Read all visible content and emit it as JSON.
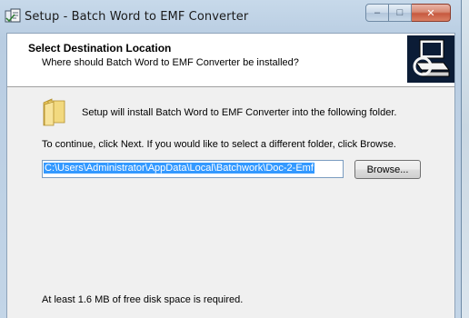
{
  "window": {
    "title": "Setup - Batch Word to EMF Converter",
    "controls": {
      "minimize": "–",
      "maximize": "□",
      "close": "✕"
    }
  },
  "header": {
    "title": "Select Destination Location",
    "subtitle": "Where should Batch Word to EMF Converter be installed?"
  },
  "body": {
    "install_text": "Setup will install Batch Word to EMF Converter into the following folder.",
    "instruction_text": "To continue, click Next. If you would like to select a different folder, click Browse.",
    "path_value": "C:\\Users\\Administrator\\AppData\\Local\\Batchwork\\Doc-2-Emf",
    "browse_label": "Browse...",
    "disk_space_text": "At least 1.6 MB of free disk space is required."
  },
  "icons": {
    "app": "setup-app-icon",
    "wizard": "computer-disk-icon",
    "folder": "folder-icon"
  },
  "colors": {
    "selection": "#3399ff",
    "close": "#c7593f"
  }
}
